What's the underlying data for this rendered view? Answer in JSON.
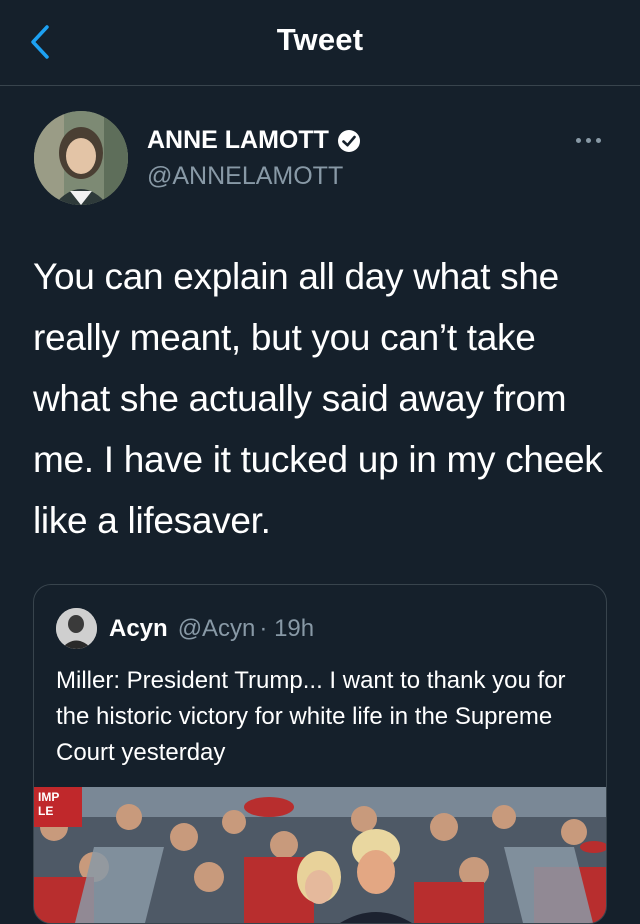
{
  "header": {
    "title": "Tweet",
    "back_icon": "chevron-left-icon",
    "accent": "#1da1f2"
  },
  "author": {
    "name": "ANNE LAMOTT",
    "handle": "@ANNELAMOTT",
    "verified_icon": "verified-badge-icon"
  },
  "tweet": {
    "text": "You can explain all day what she really meant, but you can’t take what she actually said away from me. I have it tucked up in my cheek like a lifesaver."
  },
  "quoted_tweet": {
    "name": "Acyn",
    "handle": "@Acyn",
    "time": "· 19h",
    "text": "Miller: President Trump... I want to thank you for the historic victory for white life in the Supreme Court yesterday",
    "image_sign_text": "IMP LE"
  },
  "colors": {
    "background": "#15202b",
    "border": "#38444d",
    "secondary_text": "#8899a6"
  }
}
